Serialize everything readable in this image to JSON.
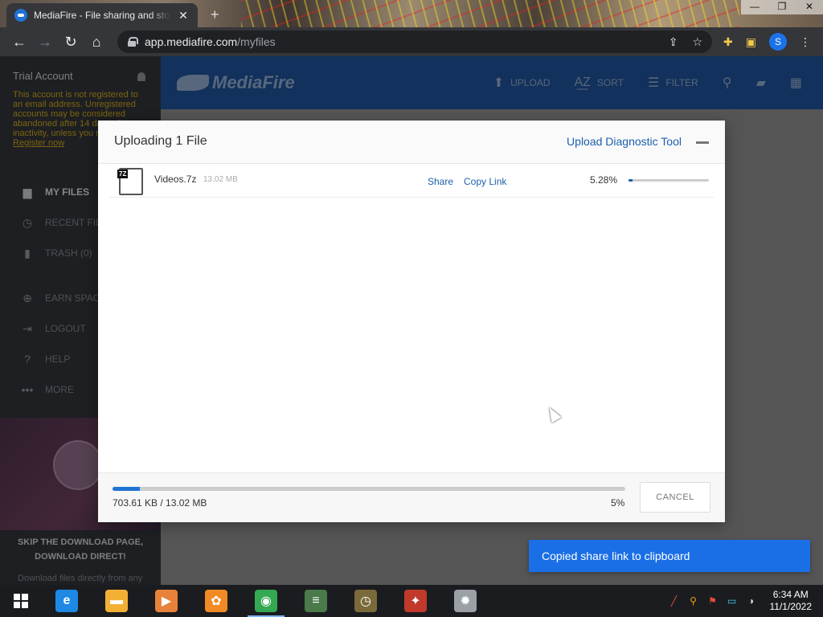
{
  "browser": {
    "tab_title": "MediaFire - File sharing and storage",
    "tab_close": "✕",
    "new_tab": "+",
    "url_domain": "app.mediafire.com",
    "url_path": "/myfiles",
    "profile_initial": "S",
    "window_controls": [
      "—",
      "❐",
      "✕"
    ]
  },
  "sidebar": {
    "account_title": "Trial Account",
    "notice": "This account is not registered to an email address. Unregistered accounts may be considered abandoned after 14 days of inactivity, unless you register.",
    "register_link": "Register now",
    "items": [
      {
        "label": "MY FILES",
        "icon": "folder-icon"
      },
      {
        "label": "RECENT FILES",
        "icon": "clock-icon"
      },
      {
        "label": "TRASH (0)",
        "icon": "trash-icon"
      },
      {
        "label": "EARN SPACE",
        "icon": "plus-circle-icon"
      },
      {
        "label": "LOGOUT",
        "icon": "logout-icon"
      },
      {
        "label": "HELP",
        "icon": "help-icon"
      },
      {
        "label": "MORE",
        "icon": "more-icon"
      }
    ],
    "promo_title_1": "SKIP THE DOWNLOAD PAGE,",
    "promo_title_2": "DOWNLOAD DIRECT!",
    "promo_sub": "Download files directly from any"
  },
  "header": {
    "logo_text": "MediaFire",
    "upload": "UPLOAD",
    "sort": "SORT",
    "filter": "FILTER"
  },
  "dialog": {
    "title": "Uploading 1 File",
    "diagnostic": "Upload Diagnostic Tool",
    "file": {
      "type_tag": "7Z",
      "name": "Videos.7z",
      "size": "13.02 MB",
      "share": "Share",
      "copy_link": "Copy Link",
      "percent_text": "5.28%",
      "progress": 0.0528
    },
    "footer": {
      "bytes": "703.61 KB / 13.02 MB",
      "percent_text": "5%",
      "progress": 0.0528,
      "cancel": "CANCEL"
    }
  },
  "toast": "Copied share link to clipboard",
  "taskbar": {
    "time": "6:34 AM",
    "date": "11/1/2022",
    "apps": [
      {
        "name": "internet-explorer",
        "color": "#1e88e5",
        "glyph": "e"
      },
      {
        "name": "file-explorer",
        "color": "#f2b134",
        "glyph": "▬"
      },
      {
        "name": "media-player",
        "color": "#e8823a",
        "glyph": "▶"
      },
      {
        "name": "uc-browser",
        "color": "#f08a24",
        "glyph": "✿"
      },
      {
        "name": "chrome",
        "color": "#34a853",
        "glyph": "◉"
      },
      {
        "name": "notepad-app",
        "color": "#4a7a4a",
        "glyph": "≡"
      },
      {
        "name": "clock-app",
        "color": "#7a6a3a",
        "glyph": "◷"
      },
      {
        "name": "color-app",
        "color": "#c0392b",
        "glyph": "✦"
      },
      {
        "name": "settings-app",
        "color": "#9aa0a6",
        "glyph": "✹"
      }
    ]
  },
  "colors": {
    "accent": "#1c5fad",
    "progress": "#1f74d4",
    "toast": "#1a6fe6",
    "header": "#1d4f95"
  }
}
